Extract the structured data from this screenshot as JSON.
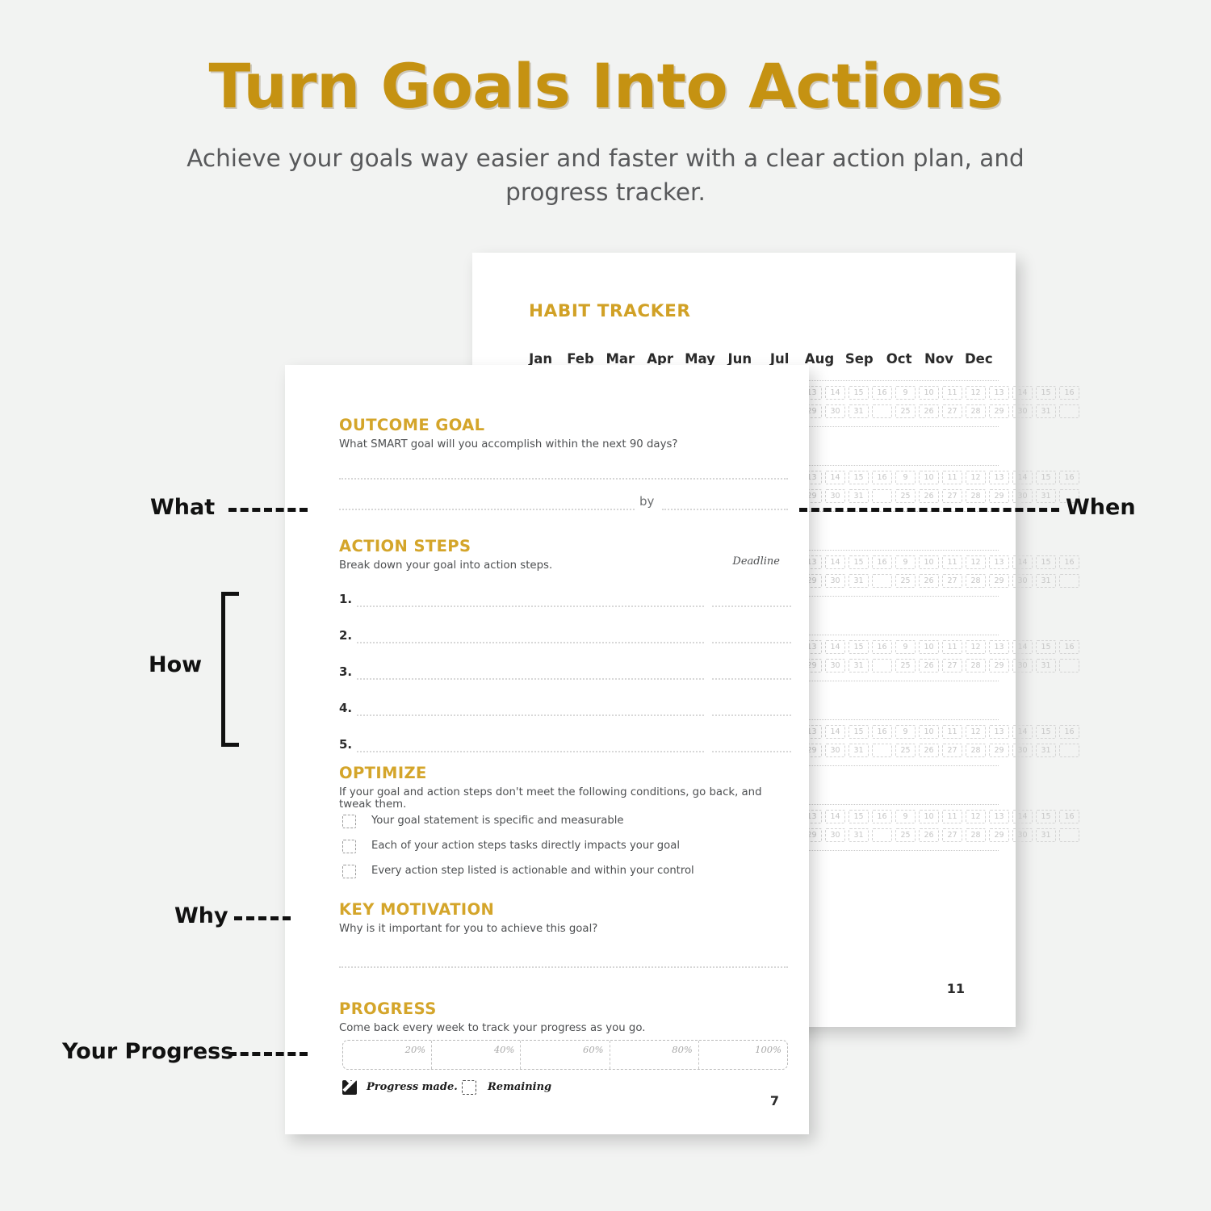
{
  "header": {
    "title": "Turn Goals Into Actions",
    "subtitle": "Achieve your goals way easier and faster with a clear action plan, and progress tracker."
  },
  "colors": {
    "hero_gold": "#C59212",
    "heading_gold": "#D4A52A",
    "background": "#F2F3F2",
    "page": "#FFFFFF",
    "body_text": "#4D4F51",
    "annotation": "#111111"
  },
  "annotations": [
    {
      "label": "What",
      "name": "what"
    },
    {
      "label": "When",
      "name": "when"
    },
    {
      "label": "How",
      "name": "how"
    },
    {
      "label": "Why",
      "name": "why"
    },
    {
      "label": "Your Progress",
      "name": "your-progress"
    }
  ],
  "habit_tracker_page": {
    "title": "HABIT TRACKER",
    "page_number": "11",
    "months": [
      "Jan",
      "Feb",
      "Mar",
      "Apr",
      "May",
      "Jun",
      "Jul",
      "Aug",
      "Sep",
      "Oct",
      "Nov",
      "Dec"
    ],
    "day_rows": [
      [
        "9",
        "10",
        "11",
        "12",
        "13",
        "14",
        "15",
        "16"
      ],
      [
        "25",
        "26",
        "27",
        "28",
        "29",
        "30",
        "31",
        ""
      ]
    ],
    "visible_blocks": 6
  },
  "goal_page": {
    "page_number": "7",
    "outcome_goal": {
      "heading": "OUTCOME GOAL",
      "prompt": "What SMART goal will you accomplish within the next 90 days?",
      "by_label": "by"
    },
    "action_steps": {
      "heading": "ACTION STEPS",
      "prompt": "Break down your goal into action steps.",
      "deadline_label": "Deadline",
      "numbers": [
        "1.",
        "2.",
        "3.",
        "4.",
        "5."
      ]
    },
    "optimize": {
      "heading": "OPTIMIZE",
      "prompt": "If your goal and action steps don't meet the following conditions, go back, and tweak them.",
      "items": [
        "Your goal statement is specific and measurable",
        "Each of your action steps tasks directly impacts your goal",
        "Every action step listed is actionable and within your control"
      ]
    },
    "key_motivation": {
      "heading": "KEY MOTIVATION",
      "prompt": "Why is it important for you to achieve this goal?"
    },
    "progress": {
      "heading": "PROGRESS",
      "prompt": "Come back every week to track your progress as you go.",
      "ticks": [
        "20%",
        "40%",
        "60%",
        "80%",
        "100%"
      ],
      "legend": [
        {
          "label": "Progress made.",
          "style": "filled"
        },
        {
          "label": "Remaining",
          "style": "dashed"
        }
      ]
    }
  }
}
